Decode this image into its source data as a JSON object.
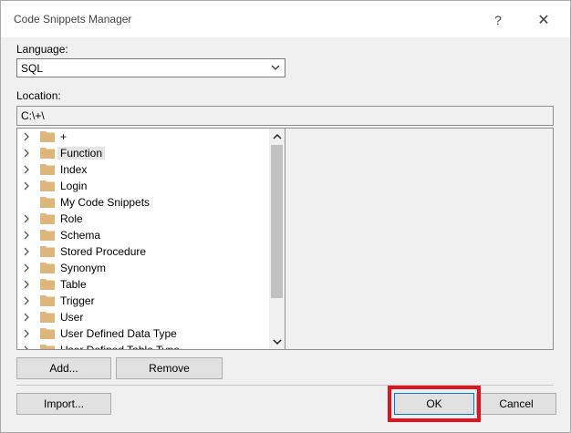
{
  "window": {
    "title": "Code Snippets Manager",
    "help_glyph": "?",
    "close_glyph": "✕"
  },
  "language": {
    "label": "Language:",
    "selected": "SQL"
  },
  "location": {
    "label": "Location:",
    "value": "C:\\+\\"
  },
  "tree": {
    "items": [
      {
        "label": "+",
        "expandable": true,
        "selected": false
      },
      {
        "label": "Function",
        "expandable": true,
        "selected": true
      },
      {
        "label": "Index",
        "expandable": true,
        "selected": false
      },
      {
        "label": "Login",
        "expandable": true,
        "selected": false
      },
      {
        "label": "My Code Snippets",
        "expandable": false,
        "selected": false
      },
      {
        "label": "Role",
        "expandable": true,
        "selected": false
      },
      {
        "label": "Schema",
        "expandable": true,
        "selected": false
      },
      {
        "label": "Stored Procedure",
        "expandable": true,
        "selected": false
      },
      {
        "label": "Synonym",
        "expandable": true,
        "selected": false
      },
      {
        "label": "Table",
        "expandable": true,
        "selected": false
      },
      {
        "label": "Trigger",
        "expandable": true,
        "selected": false
      },
      {
        "label": "User",
        "expandable": true,
        "selected": false
      },
      {
        "label": "User Defined Data Type",
        "expandable": true,
        "selected": false
      },
      {
        "label": "User Defined Table Type",
        "expandable": true,
        "selected": false
      }
    ]
  },
  "buttons": {
    "add": "Add...",
    "remove": "Remove",
    "import": "Import...",
    "ok": "OK",
    "cancel": "Cancel"
  },
  "colors": {
    "folder": "#dcb67a",
    "highlight": "#e0141e",
    "selection": "#e5e5e5"
  }
}
